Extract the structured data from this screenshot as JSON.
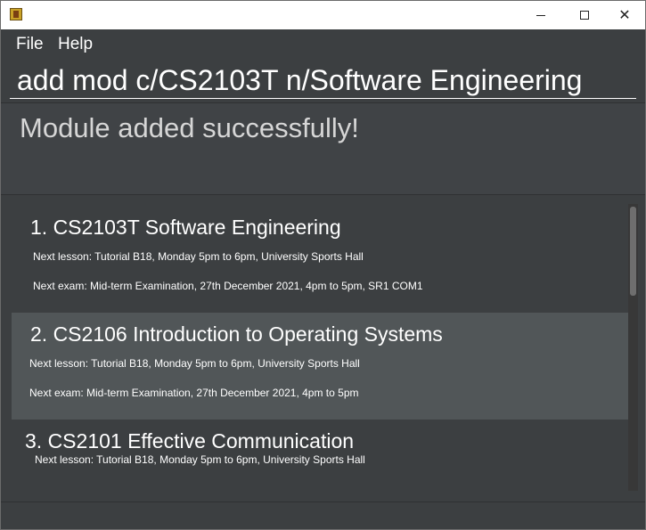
{
  "menu": {
    "file": "File",
    "help": "Help"
  },
  "command": {
    "value": "add mod c/CS2103T n/Software Engineering"
  },
  "result": {
    "message": "Module added successfully!"
  },
  "modules": [
    {
      "title": "1. CS2103T Software Engineering",
      "lesson": "Next lesson: Tutorial B18, Monday 5pm to 6pm, University Sports Hall",
      "exam": "Next exam: Mid-term Examination, 27th December 2021, 4pm to 5pm, SR1 COM1"
    },
    {
      "title": "2. CS2106 Introduction to Operating Systems",
      "lesson": "Next lesson: Tutorial B18, Monday 5pm to 6pm, University Sports Hall",
      "exam": "Next exam: Mid-term Examination, 27th December 2021, 4pm to 5pm"
    },
    {
      "title": "3. CS2101 Effective Communication",
      "lesson": "Next lesson: Tutorial B18, Monday 5pm to 6pm, University Sports Hall"
    }
  ],
  "icons": {
    "app": "app-icon",
    "minimize": "minimize-icon",
    "maximize": "maximize-icon",
    "close": "close-icon"
  },
  "colors": {
    "background": "#3c3f41",
    "selected_card": "#515658",
    "text": "#ffffff"
  }
}
